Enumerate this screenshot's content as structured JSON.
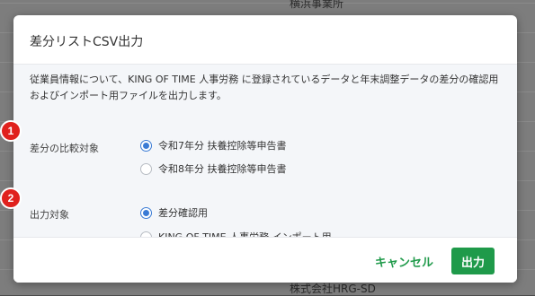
{
  "background": {
    "top_text": "横浜事業所",
    "bottom_text": "株式会社HRG-SD"
  },
  "dialog": {
    "title": "差分リストCSV出力",
    "description": "従業員情報について、KING OF TIME 人事労務 に登録されているデータと年末調整データの差分の確認用およびインポート用ファイルを出力します。",
    "compare_target": {
      "label": "差分の比較対象",
      "options": [
        {
          "label": "令和7年分 扶養控除等申告書",
          "checked": true
        },
        {
          "label": "令和8年分 扶養控除等申告書",
          "checked": false
        }
      ]
    },
    "output_target": {
      "label": "出力対象",
      "options": [
        {
          "label": "差分確認用",
          "checked": true
        },
        {
          "label": "KING OF TIME 人事労務 インポート用",
          "checked": false
        }
      ]
    },
    "cancel_label": "キャンセル",
    "submit_label": "出力"
  },
  "annotations": [
    "1",
    "2"
  ],
  "colors": {
    "primary_green": "#1f9a4a",
    "radio_blue": "#3a7bd5",
    "badge_red": "#e0211d"
  }
}
